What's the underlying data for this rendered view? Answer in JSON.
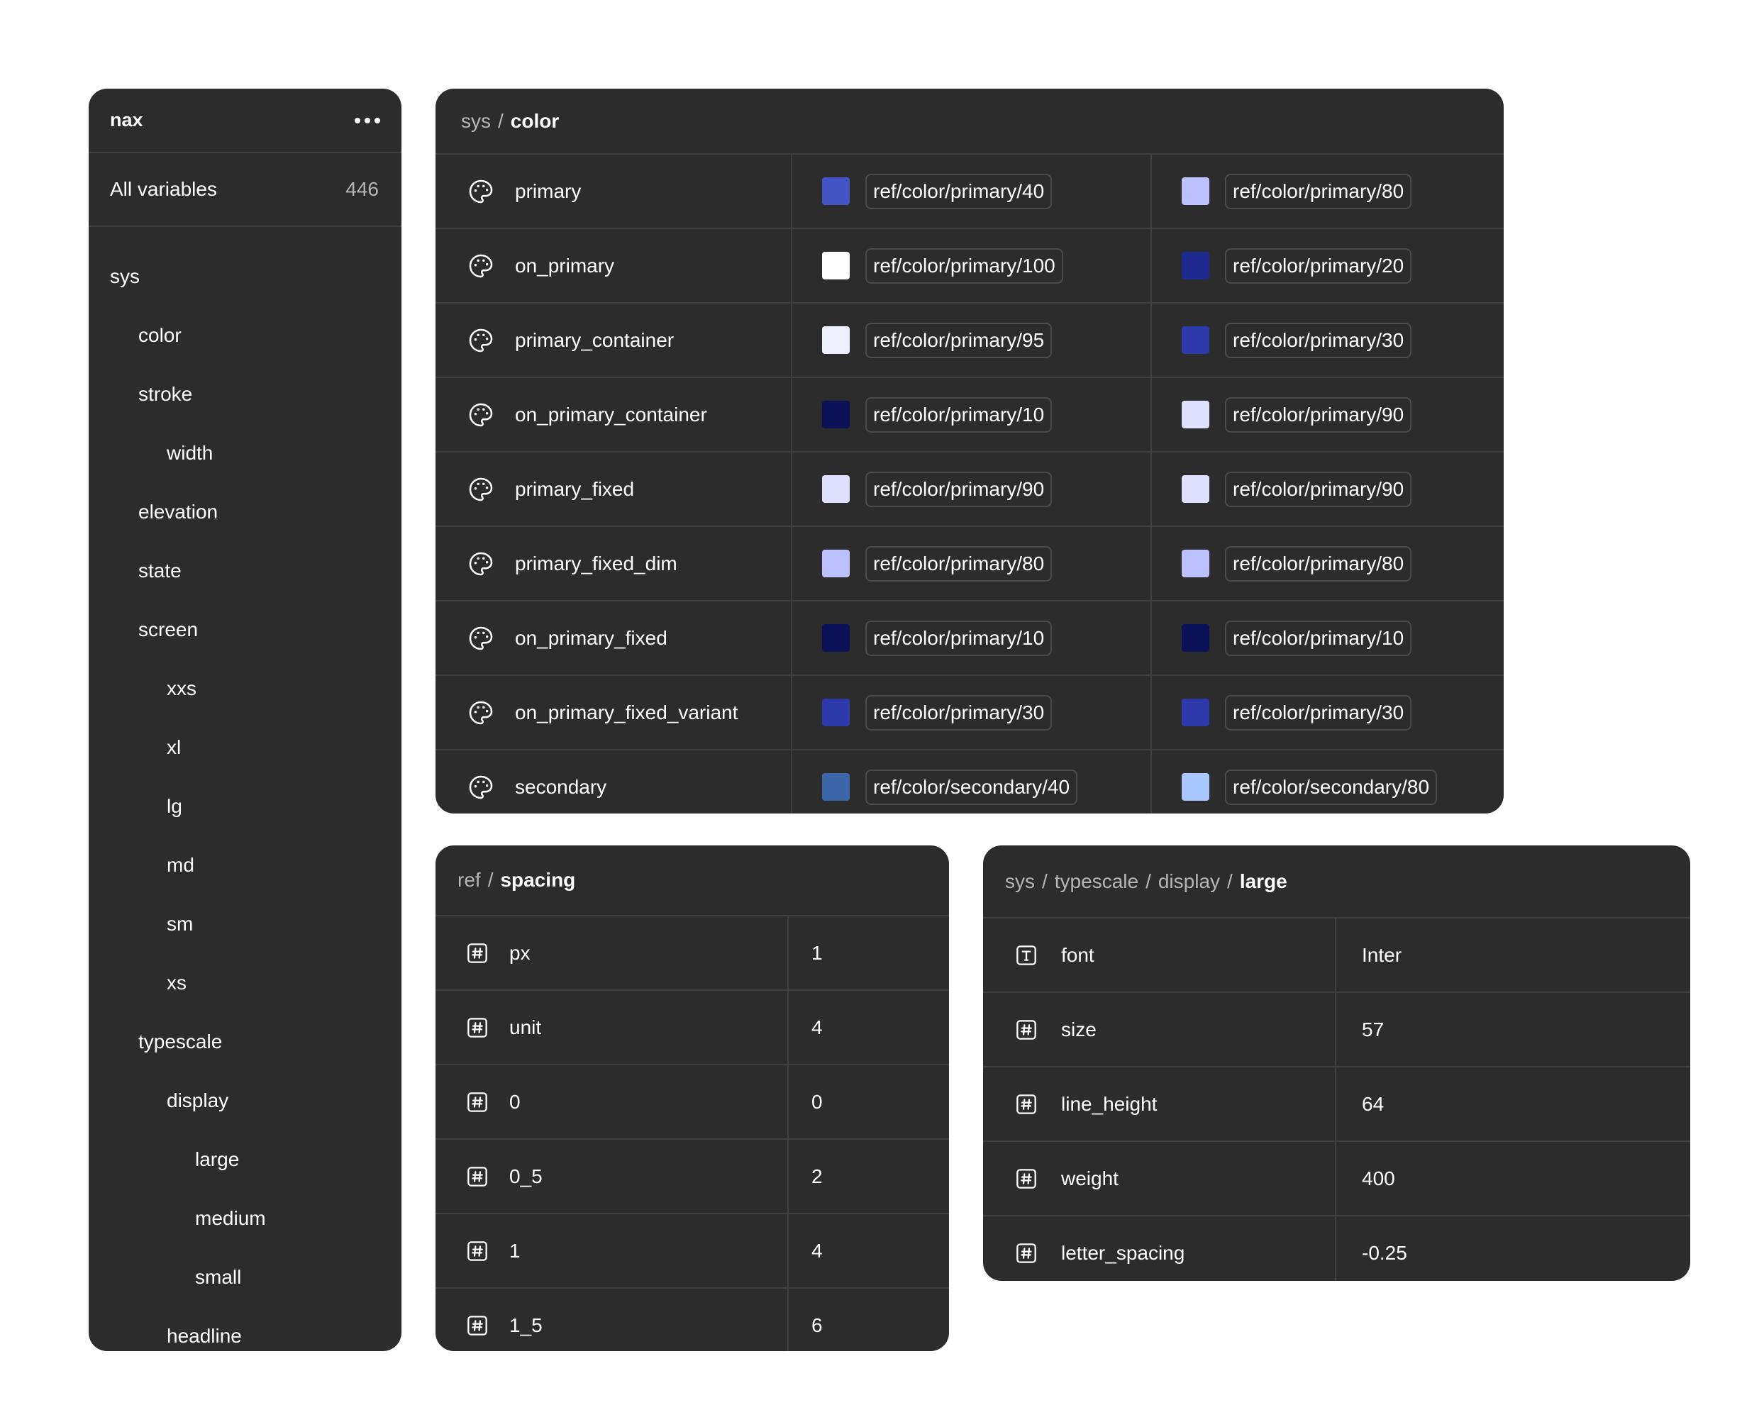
{
  "sidebar": {
    "title": "nax",
    "all_label": "All variables",
    "all_count": "446",
    "items": [
      {
        "label": "sys",
        "level": 0
      },
      {
        "label": "color",
        "level": 1
      },
      {
        "label": "stroke",
        "level": 1
      },
      {
        "label": "width",
        "level": 2
      },
      {
        "label": "elevation",
        "level": 1
      },
      {
        "label": "state",
        "level": 1
      },
      {
        "label": "screen",
        "level": 1
      },
      {
        "label": "xxs",
        "level": 2
      },
      {
        "label": "xl",
        "level": 2
      },
      {
        "label": "lg",
        "level": 2
      },
      {
        "label": "md",
        "level": 2
      },
      {
        "label": "sm",
        "level": 2
      },
      {
        "label": "xs",
        "level": 2
      },
      {
        "label": "typescale",
        "level": 1
      },
      {
        "label": "display",
        "level": 2
      },
      {
        "label": "large",
        "level": 3
      },
      {
        "label": "medium",
        "level": 3
      },
      {
        "label": "small",
        "level": 3
      },
      {
        "label": "headline",
        "level": 2
      }
    ]
  },
  "color_panel": {
    "breadcrumb": {
      "parent": "sys",
      "separator": "/",
      "current": "color"
    },
    "rows": [
      {
        "name": "primary",
        "light": {
          "ref": "ref/color/primary/40",
          "swatch": "#4355c4"
        },
        "dark": {
          "ref": "ref/color/primary/80",
          "swatch": "#bcc2ff"
        }
      },
      {
        "name": "on_primary",
        "light": {
          "ref": "ref/color/primary/100",
          "swatch": "#ffffff"
        },
        "dark": {
          "ref": "ref/color/primary/20",
          "swatch": "#1e2a8f"
        }
      },
      {
        "name": "primary_container",
        "light": {
          "ref": "ref/color/primary/95",
          "swatch": "#eef0ff"
        },
        "dark": {
          "ref": "ref/color/primary/30",
          "swatch": "#2c3aab"
        }
      },
      {
        "name": "on_primary_container",
        "light": {
          "ref": "ref/color/primary/10",
          "swatch": "#0c1257"
        },
        "dark": {
          "ref": "ref/color/primary/90",
          "swatch": "#dfe0ff"
        }
      },
      {
        "name": "primary_fixed",
        "light": {
          "ref": "ref/color/primary/90",
          "swatch": "#dfe0ff"
        },
        "dark": {
          "ref": "ref/color/primary/90",
          "swatch": "#dfe0ff"
        }
      },
      {
        "name": "primary_fixed_dim",
        "light": {
          "ref": "ref/color/primary/80",
          "swatch": "#bcc2ff"
        },
        "dark": {
          "ref": "ref/color/primary/80",
          "swatch": "#bcc2ff"
        }
      },
      {
        "name": "on_primary_fixed",
        "light": {
          "ref": "ref/color/primary/10",
          "swatch": "#0c1257"
        },
        "dark": {
          "ref": "ref/color/primary/10",
          "swatch": "#0c1257"
        }
      },
      {
        "name": "on_primary_fixed_variant",
        "light": {
          "ref": "ref/color/primary/30",
          "swatch": "#2c3aab"
        },
        "dark": {
          "ref": "ref/color/primary/30",
          "swatch": "#2c3aab"
        }
      },
      {
        "name": "secondary",
        "light": {
          "ref": "ref/color/secondary/40",
          "swatch": "#3b66a8"
        },
        "dark": {
          "ref": "ref/color/secondary/80",
          "swatch": "#a8c8ff"
        }
      }
    ]
  },
  "spacing_panel": {
    "breadcrumb": {
      "parent": "ref",
      "separator": "/",
      "current": "spacing"
    },
    "rows": [
      {
        "name": "px",
        "value": "1"
      },
      {
        "name": "unit",
        "value": "4"
      },
      {
        "name": "0",
        "value": "0"
      },
      {
        "name": "0_5",
        "value": "2"
      },
      {
        "name": "1",
        "value": "4"
      },
      {
        "name": "1_5",
        "value": "6"
      }
    ]
  },
  "type_panel": {
    "breadcrumb": {
      "p1": "sys",
      "p2": "typescale",
      "p3": "display",
      "separator": "/",
      "current": "large"
    },
    "rows": [
      {
        "name": "font",
        "value": "Inter",
        "icon": "text-type-icon"
      },
      {
        "name": "size",
        "value": "57",
        "icon": "number-icon"
      },
      {
        "name": "line_height",
        "value": "64",
        "icon": "number-icon"
      },
      {
        "name": "weight",
        "value": "400",
        "icon": "number-icon"
      },
      {
        "name": "letter_spacing",
        "value": "-0.25",
        "icon": "number-icon"
      }
    ]
  },
  "icons": {
    "color_row": "palette-icon",
    "number_row": "number-icon",
    "string_row": "text-type-icon",
    "menu": "more-horizontal-icon"
  }
}
